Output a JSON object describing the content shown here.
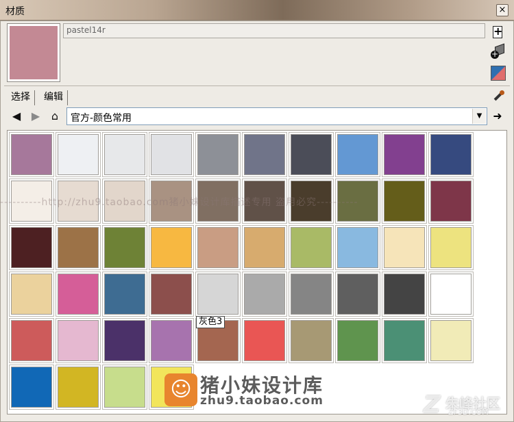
{
  "window": {
    "title": "材质",
    "close_label": "×"
  },
  "material": {
    "name": "pastel14r",
    "preview_color": "#c38994"
  },
  "side_icons": {
    "add": "create-material-icon",
    "model": "in-model-icon",
    "sample": "sample-paint-icon"
  },
  "tabs": [
    {
      "label": "选择"
    },
    {
      "label": "编辑"
    }
  ],
  "navigation": {
    "back": "arrow-left-icon",
    "forward": "arrow-right-icon",
    "home": "home-icon",
    "library": "官方-颜色常用",
    "details": "details-arrow-icon"
  },
  "swatches": [
    [
      "#a6789b",
      "#eef0f3",
      "#e7e8ea",
      "#e1e2e5",
      "#8d9097",
      "#707489",
      "#4b4d58",
      "#6398d3",
      "#82408f",
      "#364a7f"
    ],
    [
      "#f4eee7",
      "#e6dbd1",
      "#e2d6cb",
      "#a99282",
      "#806f62",
      "#605148",
      "#4a3d2c",
      "#6a6e42",
      "#645d1a",
      "#7e3649"
    ],
    [
      "#4d2022",
      "#9c7247",
      "#6e8236",
      "#f7b841",
      "#c99d83",
      "#d7ab6e",
      "#a9ba66",
      "#89b9e0",
      "#f6e4b9",
      "#ede37f"
    ],
    [
      "#ebd29d",
      "#d55e98",
      "#3e6c92",
      "#8c4f4c",
      "#d6d6d6",
      "#aaaaaa",
      "#858585",
      "#5f5f5f",
      "#444444",
      "#ffffff"
    ],
    [
      "#cd5b5b",
      "#e5b8d0",
      "#4b3169",
      "#a773ae",
      "#a46650",
      "#e95654",
      "#a79974",
      "#5f944e",
      "#4b9075",
      "#f1ebb7"
    ],
    [
      "#1168b6",
      "#d2b623",
      "#c7dd8c",
      "#f2e55b"
    ]
  ],
  "tooltip": "灰色3",
  "watermark": {
    "line": "----------http://zhu9.taobao.com猪小妹设计库描述专用 盗用必究----------",
    "logo_cn": "猪小妹设计库",
    "logo_url": "zhu9.taobao.com",
    "corner_cn": "朱峰社区",
    "corner_en": "ZF3D.COM"
  }
}
